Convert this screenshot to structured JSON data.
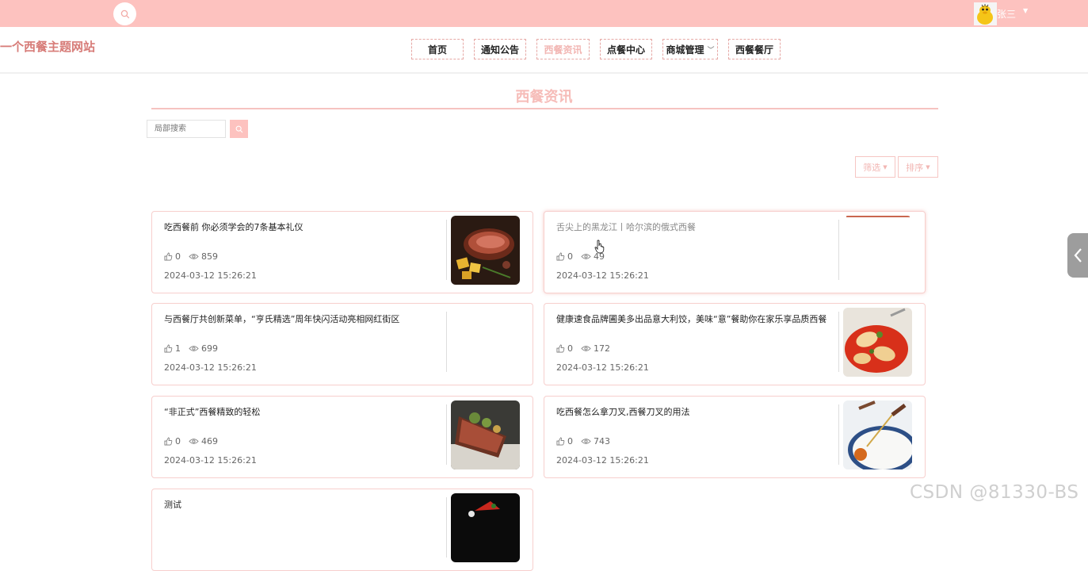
{
  "header": {
    "username": "张三",
    "site_title": "一个西餐主题网站"
  },
  "nav": [
    {
      "label": "首页",
      "active": false,
      "dropdown": false
    },
    {
      "label": "通知公告",
      "active": false,
      "dropdown": false
    },
    {
      "label": "西餐资讯",
      "active": true,
      "dropdown": false
    },
    {
      "label": "点餐中心",
      "active": false,
      "dropdown": false
    },
    {
      "label": "商城管理",
      "active": false,
      "dropdown": true
    },
    {
      "label": "西餐餐厅",
      "active": false,
      "dropdown": false
    }
  ],
  "page": {
    "heading": "西餐资讯",
    "search_placeholder": "局部搜索",
    "filter_label": "筛选",
    "sort_label": "排序"
  },
  "articles": [
    {
      "title": "吃西餐前 你必须学会的7条基本礼仪",
      "likes": "0",
      "views": "859",
      "date": "2024-03-12 15:26:21",
      "thumb": "steak"
    },
    {
      "title": "舌尖上的黑龙江丨哈尔滨的俄式西餐",
      "likes": "0",
      "views": "49",
      "date": "2024-03-12 15:26:21",
      "thumb": "strip"
    },
    {
      "title": "与西餐厅共创新菜单，“亨氏精选”周年快闪活动亮相网红街区",
      "likes": "1",
      "views": "699",
      "date": "2024-03-12 15:26:21",
      "thumb": "none"
    },
    {
      "title": "健康速食品牌圃美多出品意大利饺，美味“意”餐助你在家乐享品质西餐",
      "likes": "0",
      "views": "172",
      "date": "2024-03-12 15:26:21",
      "thumb": "ravioli"
    },
    {
      "title": "“非正式”西餐精致的轻松",
      "likes": "0",
      "views": "469",
      "date": "2024-03-12 15:26:21",
      "thumb": "plated"
    },
    {
      "title": "吃西餐怎么拿刀叉,西餐刀叉的用法",
      "likes": "0",
      "views": "743",
      "date": "2024-03-12 15:26:21",
      "thumb": "fork"
    },
    {
      "title": "测试",
      "likes": "",
      "views": "",
      "date": "",
      "thumb": "dark"
    }
  ],
  "watermark": "CSDN @81330-BS",
  "colors": {
    "accent": "#fdc2bf",
    "accent_text": "#f2b6b3",
    "title_red": "#d77c78"
  }
}
